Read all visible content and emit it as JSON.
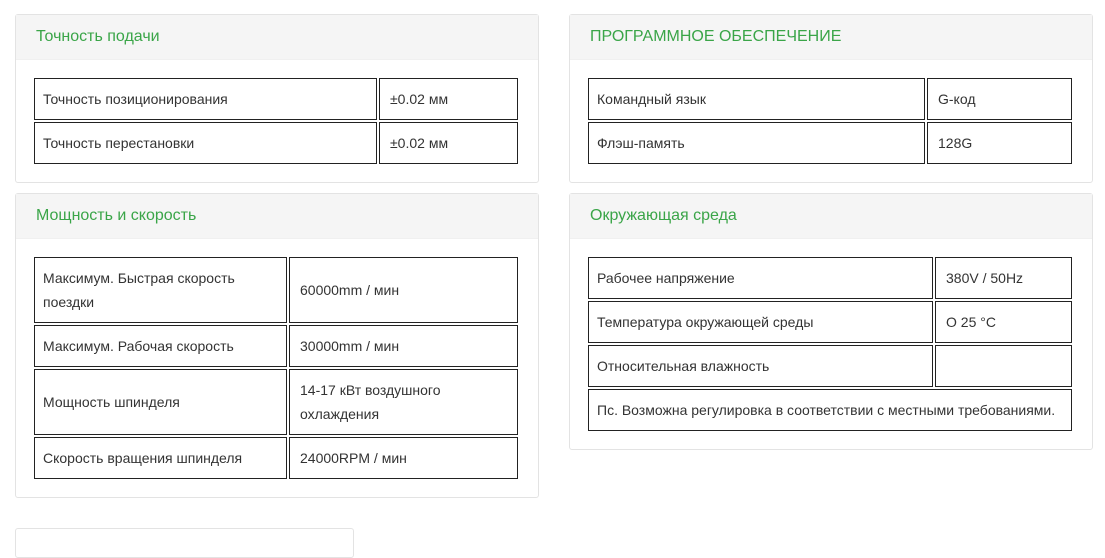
{
  "panels": [
    {
      "title": "Точность подачи",
      "rows": [
        [
          "Точность позиционирования",
          "±0.02 мм"
        ],
        [
          "Точность перестановки",
          "±0.02 мм"
        ]
      ]
    },
    {
      "title": "ПРОГРАММНОЕ ОБЕСПЕЧЕНИЕ",
      "rows": [
        [
          "Командный язык",
          "G-код"
        ],
        [
          "Флэш-память",
          "128G"
        ]
      ]
    },
    {
      "title": "Мощность и скорость",
      "rows": [
        [
          "Максимум. Быстрая скорость поездки",
          "60000mm / мин"
        ],
        [
          "Максимум. Рабочая скорость",
          "30000mm / мин"
        ],
        [
          "Мощность шпинделя",
          "14-17 кВт воздушного охлаждения"
        ],
        [
          "Скорость вращения шпинделя",
          "24000RPM / мин"
        ]
      ]
    },
    {
      "title": "Окружающая среда",
      "rows": [
        [
          "Рабочее напряжение",
          "380V / 50Hz"
        ],
        [
          "Температура окружающей среды",
          "О 25 °C"
        ],
        [
          "Относительная влажность",
          ""
        ]
      ],
      "note": "Пс. Возможна регулировка в соответствии с местными требованиями."
    }
  ]
}
